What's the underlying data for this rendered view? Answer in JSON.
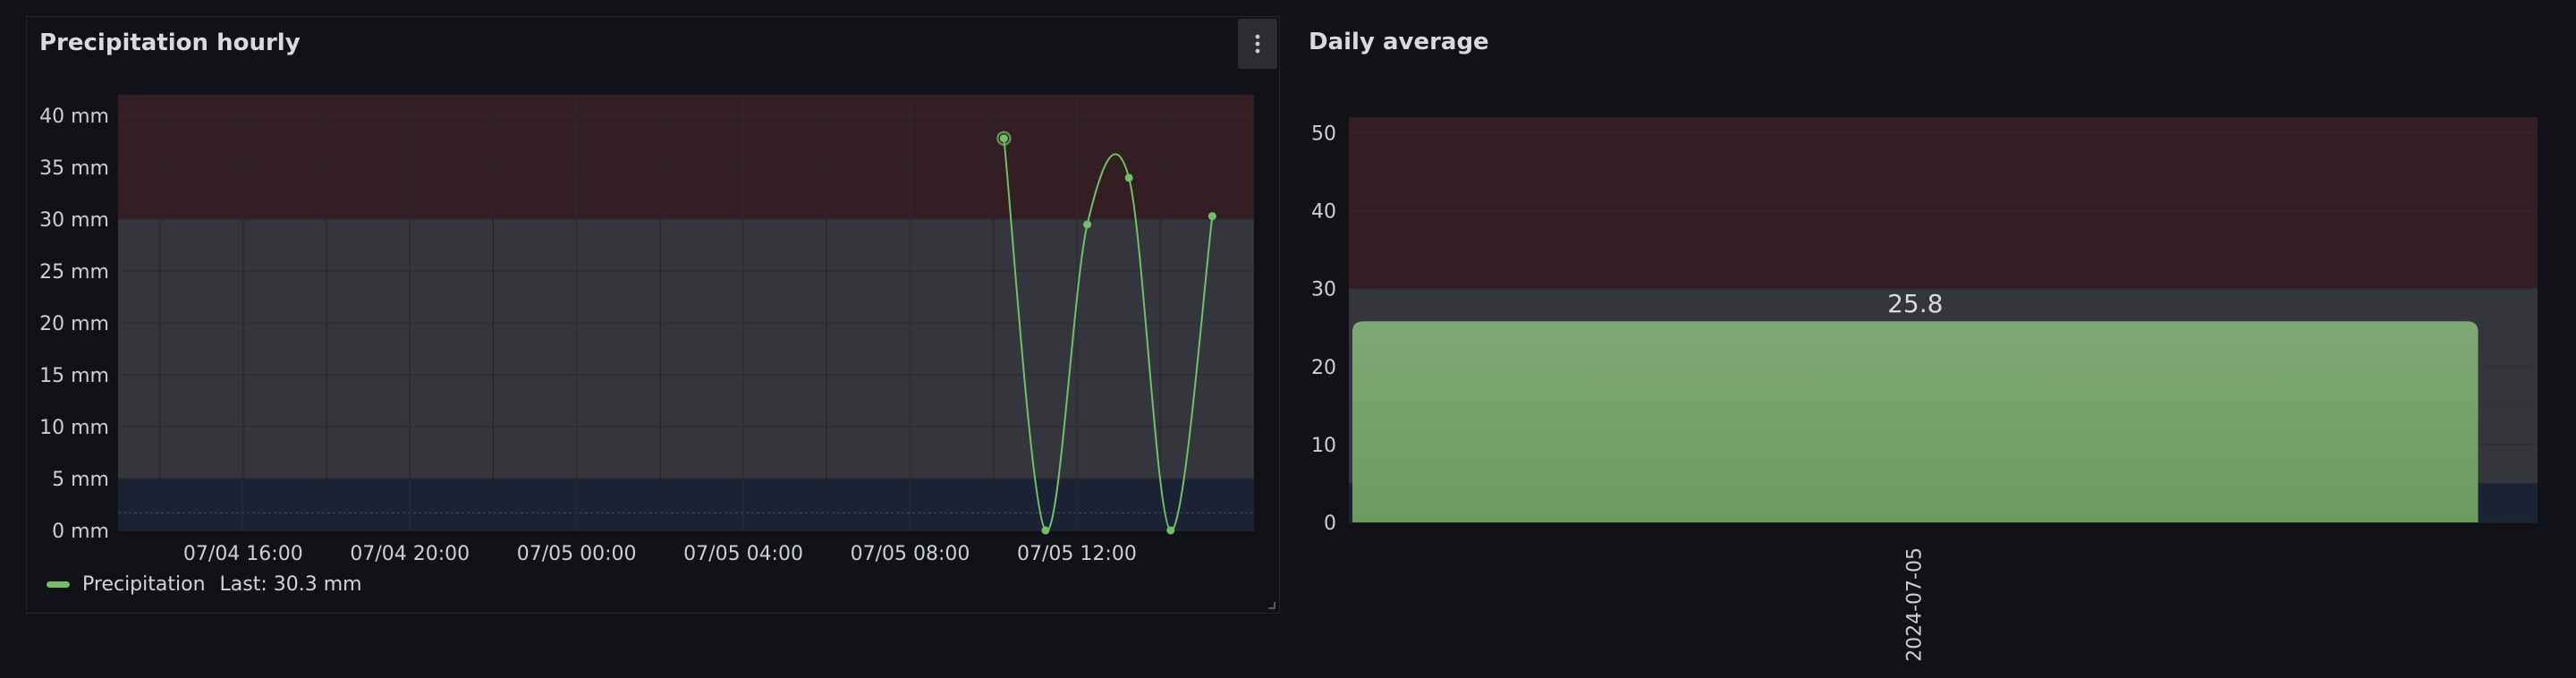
{
  "panels": {
    "hourly": {
      "title": "Precipitation hourly",
      "menu_icon": "vertical-dots-icon"
    },
    "daily": {
      "title": "Daily average"
    }
  },
  "legend": {
    "series_name": "Precipitation",
    "last_label": "Last: 30.3 mm",
    "color": "#73bf69"
  },
  "colors": {
    "threshold_high": "#331e23",
    "threshold_mid": "#35363b",
    "threshold_low": "#1b2233",
    "line": "#73bf69",
    "bar": "#73bf69",
    "grid": "#2a2c33"
  },
  "chart_data": [
    {
      "type": "line",
      "title": "Precipitation hourly",
      "xlabel": "",
      "ylabel": "",
      "x_tick_labels": [
        "07/04 16:00",
        "07/04 20:00",
        "07/05 00:00",
        "07/05 04:00",
        "07/05 08:00",
        "07/05 12:00"
      ],
      "y_tick_labels": [
        "0 mm",
        "5 mm",
        "10 mm",
        "15 mm",
        "20 mm",
        "25 mm",
        "30 mm",
        "35 mm",
        "40 mm"
      ],
      "ylim": [
        0,
        42
      ],
      "x_range": [
        "07/04 13:00",
        "07/05 16:15"
      ],
      "thresholds": [
        {
          "from": 0,
          "to": 5,
          "color": "#1b2233"
        },
        {
          "from": 5,
          "to": 30,
          "color": "#35363b"
        },
        {
          "from": 30,
          "to": 42,
          "color": "#331e23"
        }
      ],
      "series": [
        {
          "name": "Precipitation",
          "x": [
            "07/05 10:15",
            "07/05 11:15",
            "07/05 12:15",
            "07/05 13:15",
            "07/05 14:15",
            "07/05 15:15"
          ],
          "values": [
            37.8,
            0,
            29.5,
            34,
            0,
            30.3
          ]
        }
      ],
      "grid": true,
      "legend": "bottom-left"
    },
    {
      "type": "bar",
      "title": "Daily average",
      "categories": [
        "2024-07-05"
      ],
      "values": [
        25.8
      ],
      "data_labels": [
        "25.8"
      ],
      "y_tick_labels": [
        "0",
        "10",
        "20",
        "30",
        "40",
        "50"
      ],
      "ylim": [
        0,
        52
      ],
      "thresholds": [
        {
          "from": 0,
          "to": 5,
          "color": "#1b2233"
        },
        {
          "from": 5,
          "to": 30,
          "color": "#35363b"
        },
        {
          "from": 30,
          "to": 52,
          "color": "#331e23"
        }
      ],
      "grid": true
    }
  ]
}
